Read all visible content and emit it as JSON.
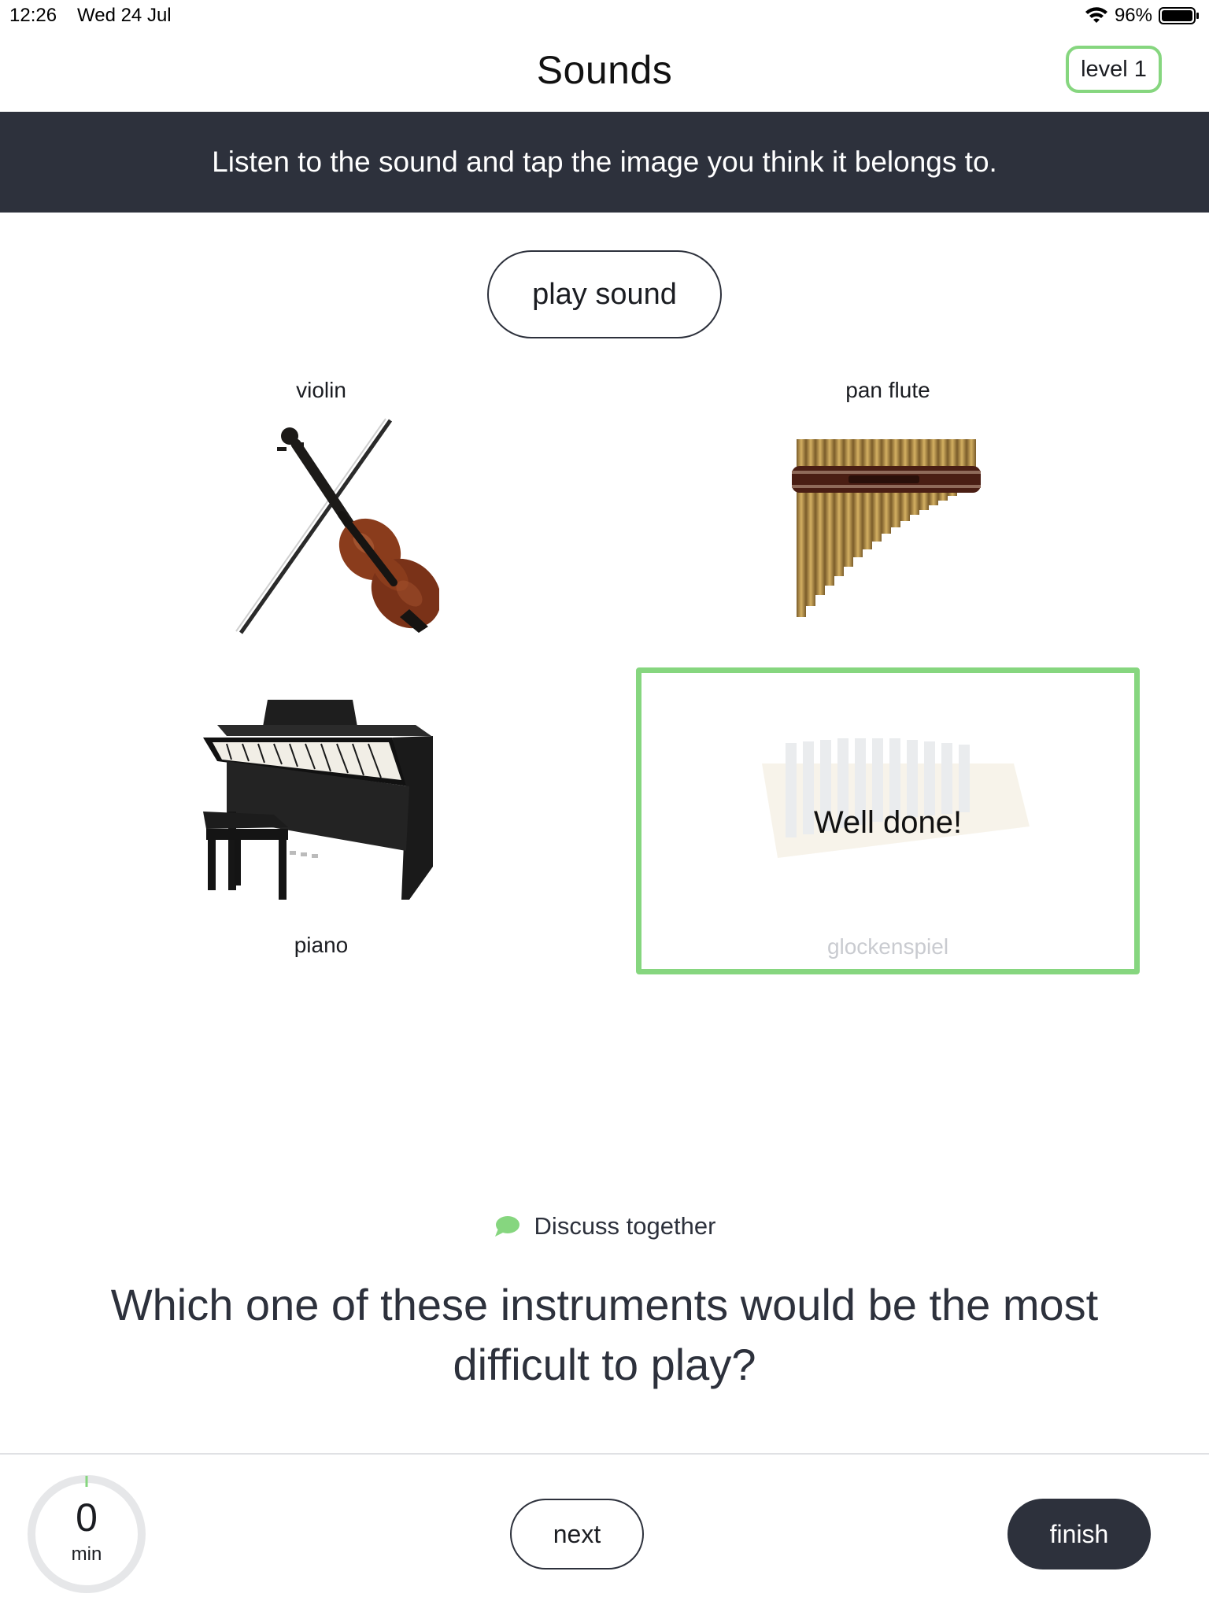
{
  "status_bar": {
    "time": "12:26",
    "date": "Wed 24 Jul",
    "battery": "96%",
    "icons": [
      "wifi-icon",
      "battery-icon"
    ]
  },
  "header": {
    "title": "Sounds",
    "level": "level 1"
  },
  "instruction": "Listen to the sound and tap the image you think it belongs to.",
  "play_button": "play sound",
  "tiles": [
    {
      "label": "violin",
      "icon": "violin-image"
    },
    {
      "label": "pan flute",
      "icon": "pan-flute-image"
    },
    {
      "label": "piano",
      "icon": "piano-image"
    },
    {
      "label": "glockenspiel",
      "icon": "glockenspiel-image",
      "selected": true,
      "feedback": "Well done!"
    }
  ],
  "discuss": {
    "icon": "chat-bubble-icon",
    "label": "Discuss together",
    "question": "Which one of these instruments would be the most difficult to play?"
  },
  "footer": {
    "timer_value": "0",
    "timer_unit": "min",
    "next_label": "next",
    "finish_label": "finish"
  },
  "colors": {
    "accent_green": "#86d67f",
    "dark": "#2d313c"
  }
}
